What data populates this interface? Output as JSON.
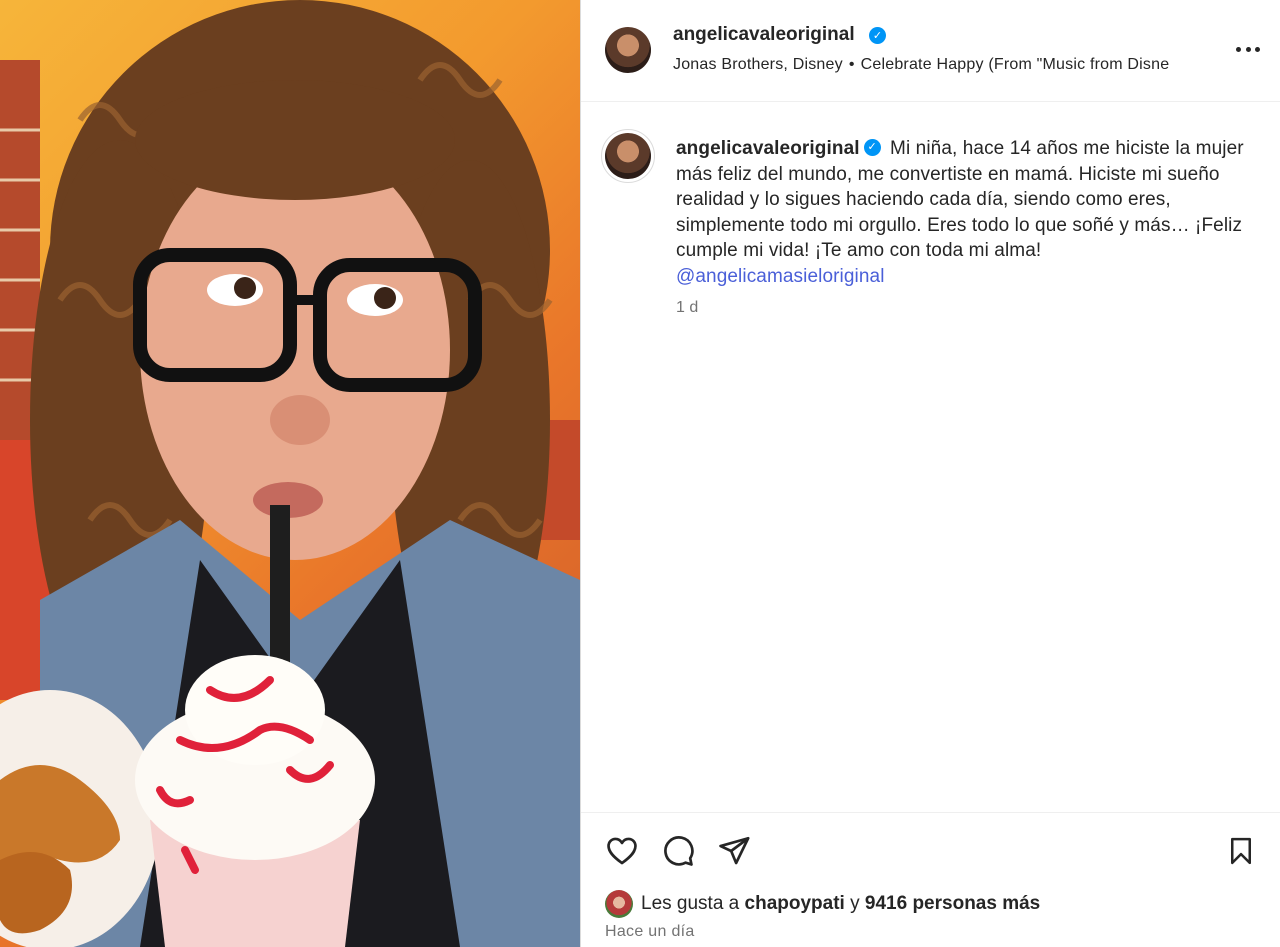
{
  "post": {
    "username": "angelicavaleoriginal",
    "verified": true,
    "audio": {
      "artist": "Jonas Brothers, Disney",
      "separator": "•",
      "track": "Celebrate Happy (From \"Music from Disne"
    },
    "caption": {
      "username": "angelicavaleoriginal",
      "text": "Mi niña, hace 14 años me hiciste la mujer más feliz del mundo, me convertiste en mamá. Hiciste mi sueño realidad y lo sigues haciendo cada día, siendo como eres, simplemente todo mi orgullo. Eres todo lo que soñé y más… ¡Feliz cumple mi vida! ¡Te amo con toda mi alma!",
      "mention": "@angelicamasieloriginal",
      "age": "1 d"
    },
    "likes": {
      "prefix": "Les gusta a",
      "user": "chapoypati",
      "conjunction": "y",
      "others": "9416 personas más"
    },
    "date": "Hace un día"
  },
  "icons": {
    "more": "more-options-icon",
    "like": "heart-icon",
    "comment": "comment-icon",
    "share": "share-icon",
    "save": "bookmark-icon",
    "verified": "verified-badge-icon"
  },
  "colors": {
    "accent_blue": "#0095f6",
    "mention": "#4a5fd8",
    "muted": "#737373",
    "text": "#262626"
  }
}
